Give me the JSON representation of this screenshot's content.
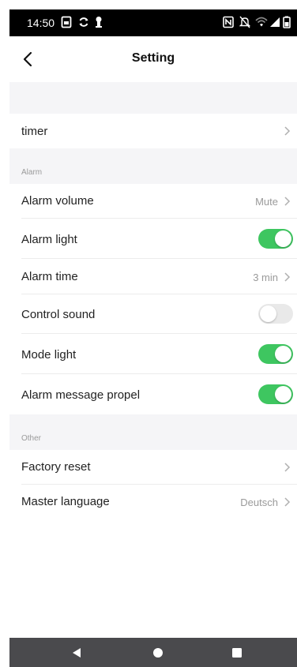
{
  "status_bar": {
    "time": "14:50",
    "left_icons": [
      "screenshot-icon",
      "sync-icon",
      "keyhole-icon"
    ],
    "right_icons": [
      "nfc-icon",
      "mute-icon",
      "wifi-icon",
      "signal-icon",
      "battery-icon"
    ]
  },
  "header": {
    "title": "Setting",
    "back_icon": "chevron-left-icon"
  },
  "rows": {
    "timer": {
      "label": "timer"
    },
    "alarm_volume": {
      "label": "Alarm volume",
      "value": "Mute"
    },
    "alarm_light": {
      "label": "Alarm light",
      "on": true
    },
    "alarm_time": {
      "label": "Alarm time",
      "value": "3 min"
    },
    "control_sound": {
      "label": "Control sound",
      "on": false
    },
    "mode_light": {
      "label": "Mode light",
      "on": true
    },
    "alarm_message_propel": {
      "label": "Alarm message propel",
      "on": true
    },
    "factory_reset": {
      "label": "Factory reset"
    },
    "master_language": {
      "label": "Master language",
      "value": "Deutsch"
    }
  },
  "sections": {
    "alarm": "Alarm",
    "other": "Other"
  },
  "colors": {
    "toggle_on": "#3ec660",
    "toggle_off": "#e9e9e9",
    "nav_bar": "#4a4a4d",
    "section_bg": "#f5f5f7"
  },
  "nav": [
    "back-triangle-icon",
    "home-circle-icon",
    "recents-square-icon"
  ]
}
